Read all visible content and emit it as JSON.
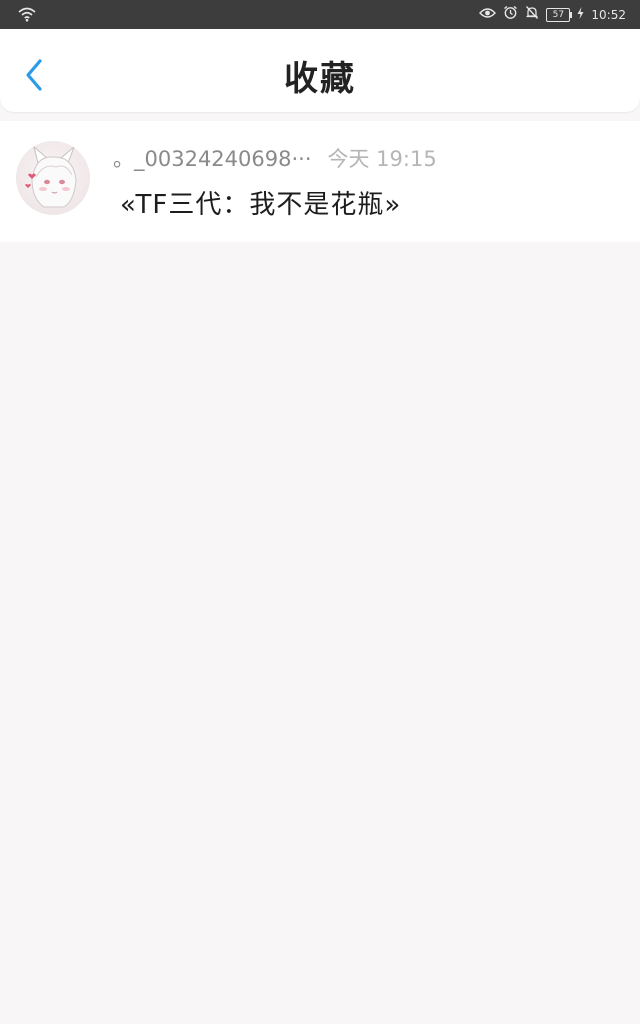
{
  "status_bar": {
    "battery": "57",
    "time": "10:52",
    "colors": {
      "background": "#3d3d3d",
      "foreground": "#e6e6e6"
    }
  },
  "header": {
    "title": "收藏",
    "back_icon": "chevron-left-icon",
    "accent_color": "#2a9be8"
  },
  "favorites": [
    {
      "author": "。_00324240698···",
      "time": "今天 19:15",
      "content": "«TF三代：我不是花瓶»"
    }
  ]
}
